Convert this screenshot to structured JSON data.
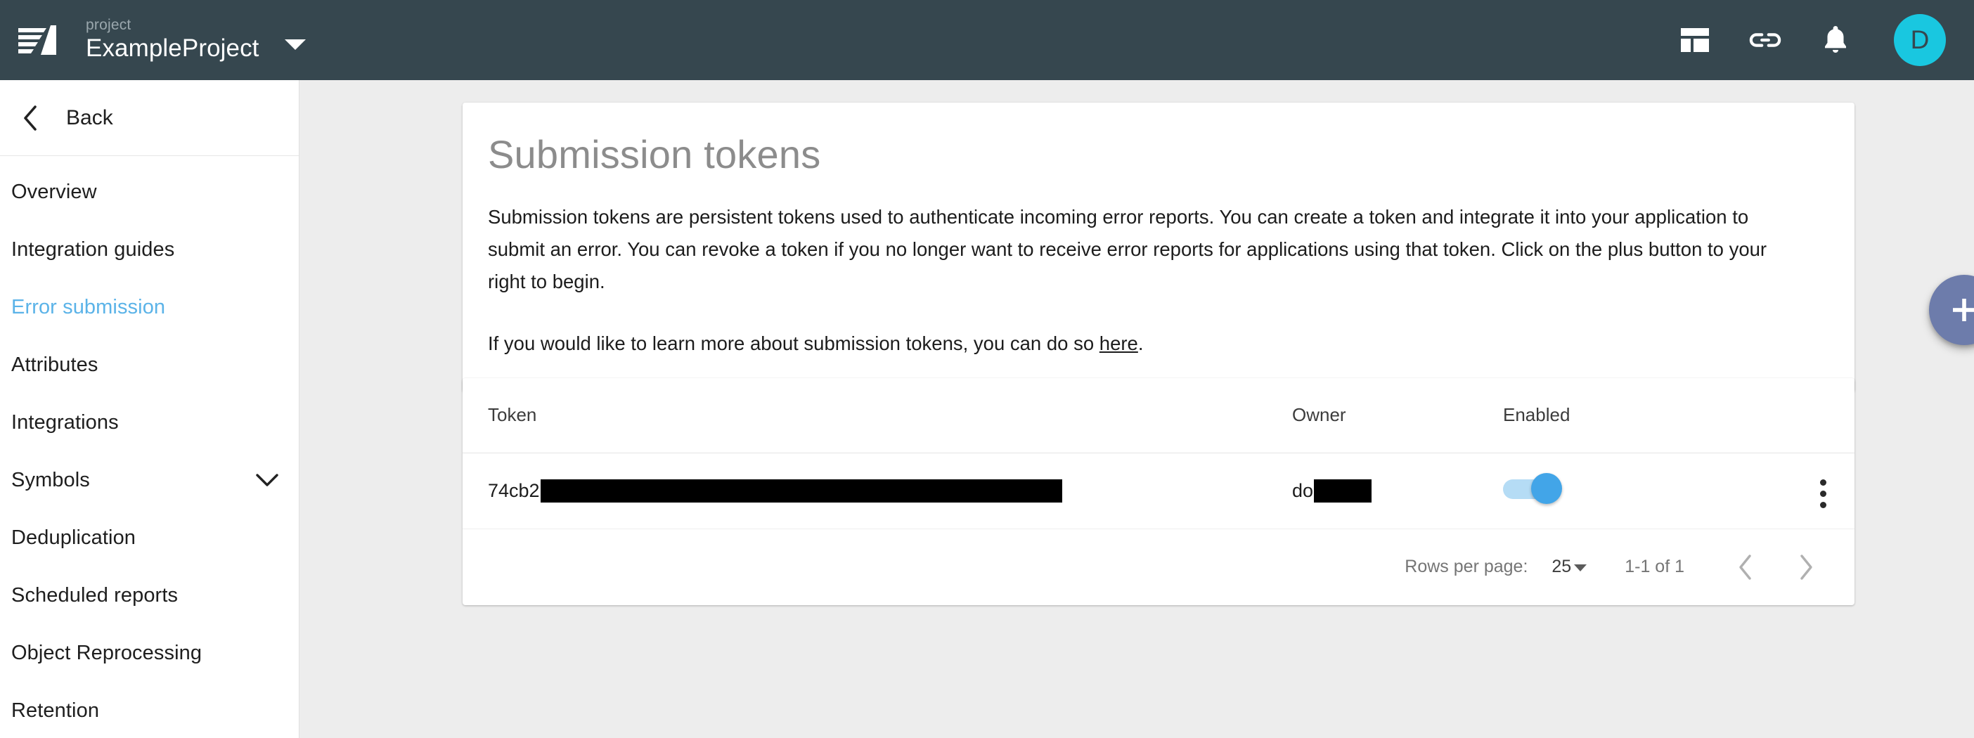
{
  "appbar": {
    "logo_alt": "backtrace-logo",
    "project_eyebrow": "project",
    "project_name": "ExampleProject",
    "caret": "dropdown-caret",
    "actions": [
      {
        "icon": "dashboard-layout-icon",
        "label": "Dashboard"
      },
      {
        "icon": "link-icon",
        "label": "Links"
      },
      {
        "icon": "bell-icon",
        "label": "Notifications"
      }
    ],
    "avatar_initial": "D",
    "bar_color": "#36474f",
    "avatar_color": "#19c7e0"
  },
  "sidebar": {
    "back_label": "Back",
    "back_icon": "chevron-left-icon",
    "active_color": "#5bb3e8",
    "items": [
      {
        "label": "Overview",
        "active": false,
        "expandable": false
      },
      {
        "label": "Integration guides",
        "active": false,
        "expandable": false
      },
      {
        "label": "Error submission",
        "active": true,
        "expandable": false
      },
      {
        "label": "Attributes",
        "active": false,
        "expandable": false
      },
      {
        "label": "Integrations",
        "active": false,
        "expandable": false
      },
      {
        "label": "Symbols",
        "active": false,
        "expandable": true
      },
      {
        "label": "Deduplication",
        "active": false,
        "expandable": false
      },
      {
        "label": "Scheduled reports",
        "active": false,
        "expandable": false
      },
      {
        "label": "Object Reprocessing",
        "active": false,
        "expandable": false
      },
      {
        "label": "Retention",
        "active": false,
        "expandable": false
      }
    ]
  },
  "main": {
    "page_title": "Submission tokens",
    "paragraph_1": "Submission tokens are persistent tokens used to authenticate incoming error reports. You can create a token and integrate it into your application to submit an error. You can revoke a token if you no longer want to receive error reports for applications using that token. Click on the plus button to your right to begin.",
    "paragraph_2_before_link": "If you would like to learn more about submission tokens, you can do so ",
    "paragraph_2_link": "here",
    "paragraph_2_after_link": ".",
    "fab": {
      "icon": "plus-icon",
      "label": "Create token",
      "color": "#6d7cab"
    }
  },
  "table": {
    "columns": [
      "Token",
      "Owner",
      "Enabled"
    ],
    "rows": [
      {
        "token_visible": "74cb2",
        "token_redacted": true,
        "owner_visible": "do",
        "owner_redacted": true,
        "enabled": true,
        "menu_icon": "kebab-menu-icon"
      }
    ],
    "toggle_on_color": "#42a5e8",
    "toggle_track_color": "#b5dcf5"
  },
  "pagination": {
    "rows_per_page_label": "Rows per page:",
    "rows_per_page_value": "25",
    "range_label": "1-1 of 1",
    "prev_icon": "chevron-left-icon",
    "next_icon": "chevron-right-icon"
  }
}
